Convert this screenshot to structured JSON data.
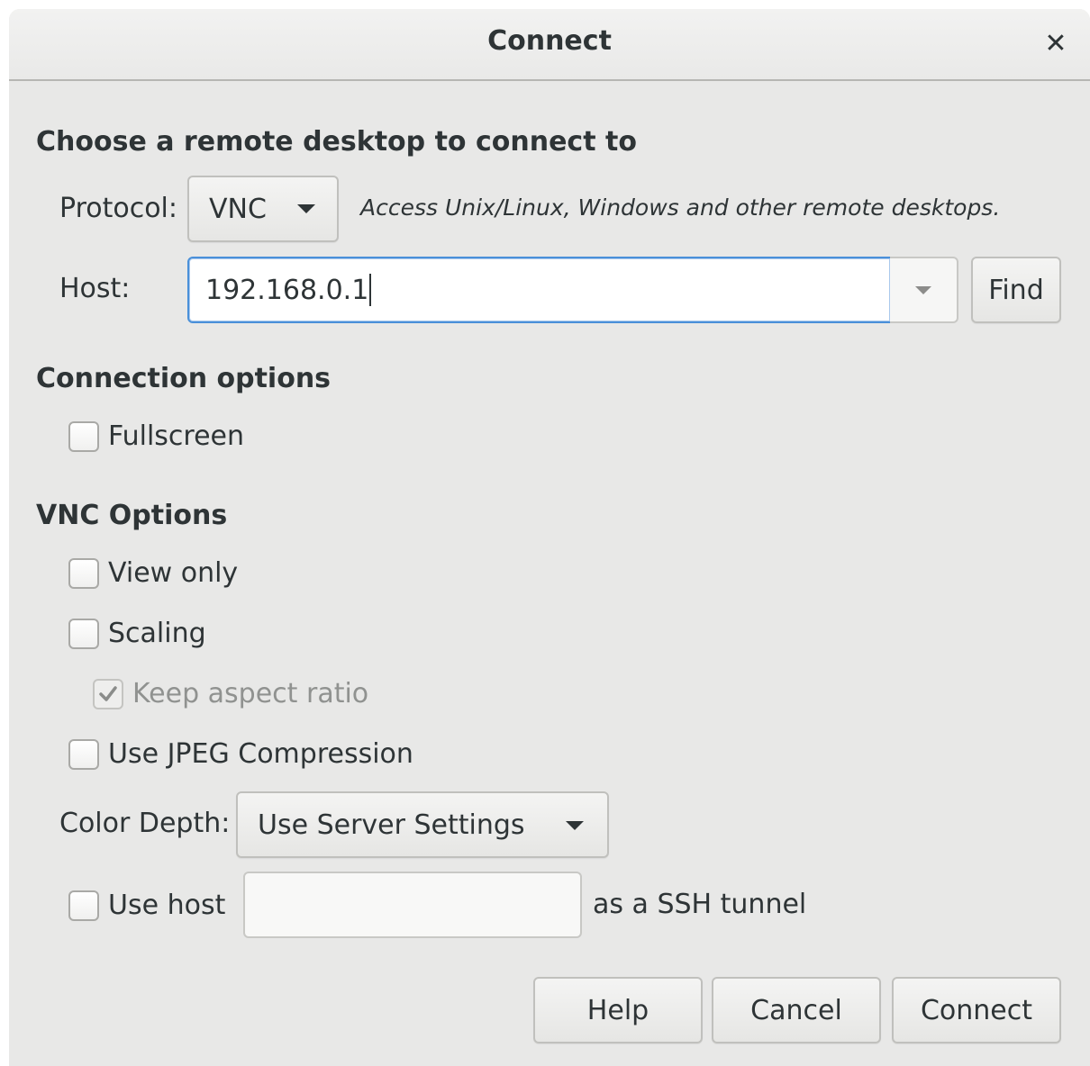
{
  "window": {
    "title": "Connect",
    "close_glyph": "✕"
  },
  "remote": {
    "heading": "Choose a remote desktop to connect to",
    "protocol_label": "Protocol:",
    "protocol_value": "VNC",
    "protocol_hint": "Access Unix/Linux, Windows and other remote desktops.",
    "host_label": "Host:",
    "host_value": "192.168.0.1",
    "find_label": "Find"
  },
  "connection_options": {
    "heading": "Connection options",
    "fullscreen_label": "Fullscreen",
    "fullscreen_checked": false
  },
  "vnc_options": {
    "heading": "VNC Options",
    "view_only_label": "View only",
    "view_only_checked": false,
    "scaling_label": "Scaling",
    "scaling_checked": false,
    "keep_aspect_label": "Keep aspect ratio",
    "keep_aspect_checked": true,
    "keep_aspect_enabled": false,
    "jpeg_label": "Use JPEG Compression",
    "jpeg_checked": false,
    "color_depth_label": "Color Depth:",
    "color_depth_value": "Use Server Settings",
    "ssh_use_host_label": "Use host",
    "ssh_use_host_checked": false,
    "ssh_host_value": "",
    "ssh_suffix_label": "as a SSH tunnel"
  },
  "buttons": {
    "help": "Help",
    "cancel": "Cancel",
    "connect": "Connect"
  },
  "colors": {
    "dialog_bg": "#e8e8e7",
    "focus_border": "#4a90d9",
    "text": "#2e3436"
  }
}
